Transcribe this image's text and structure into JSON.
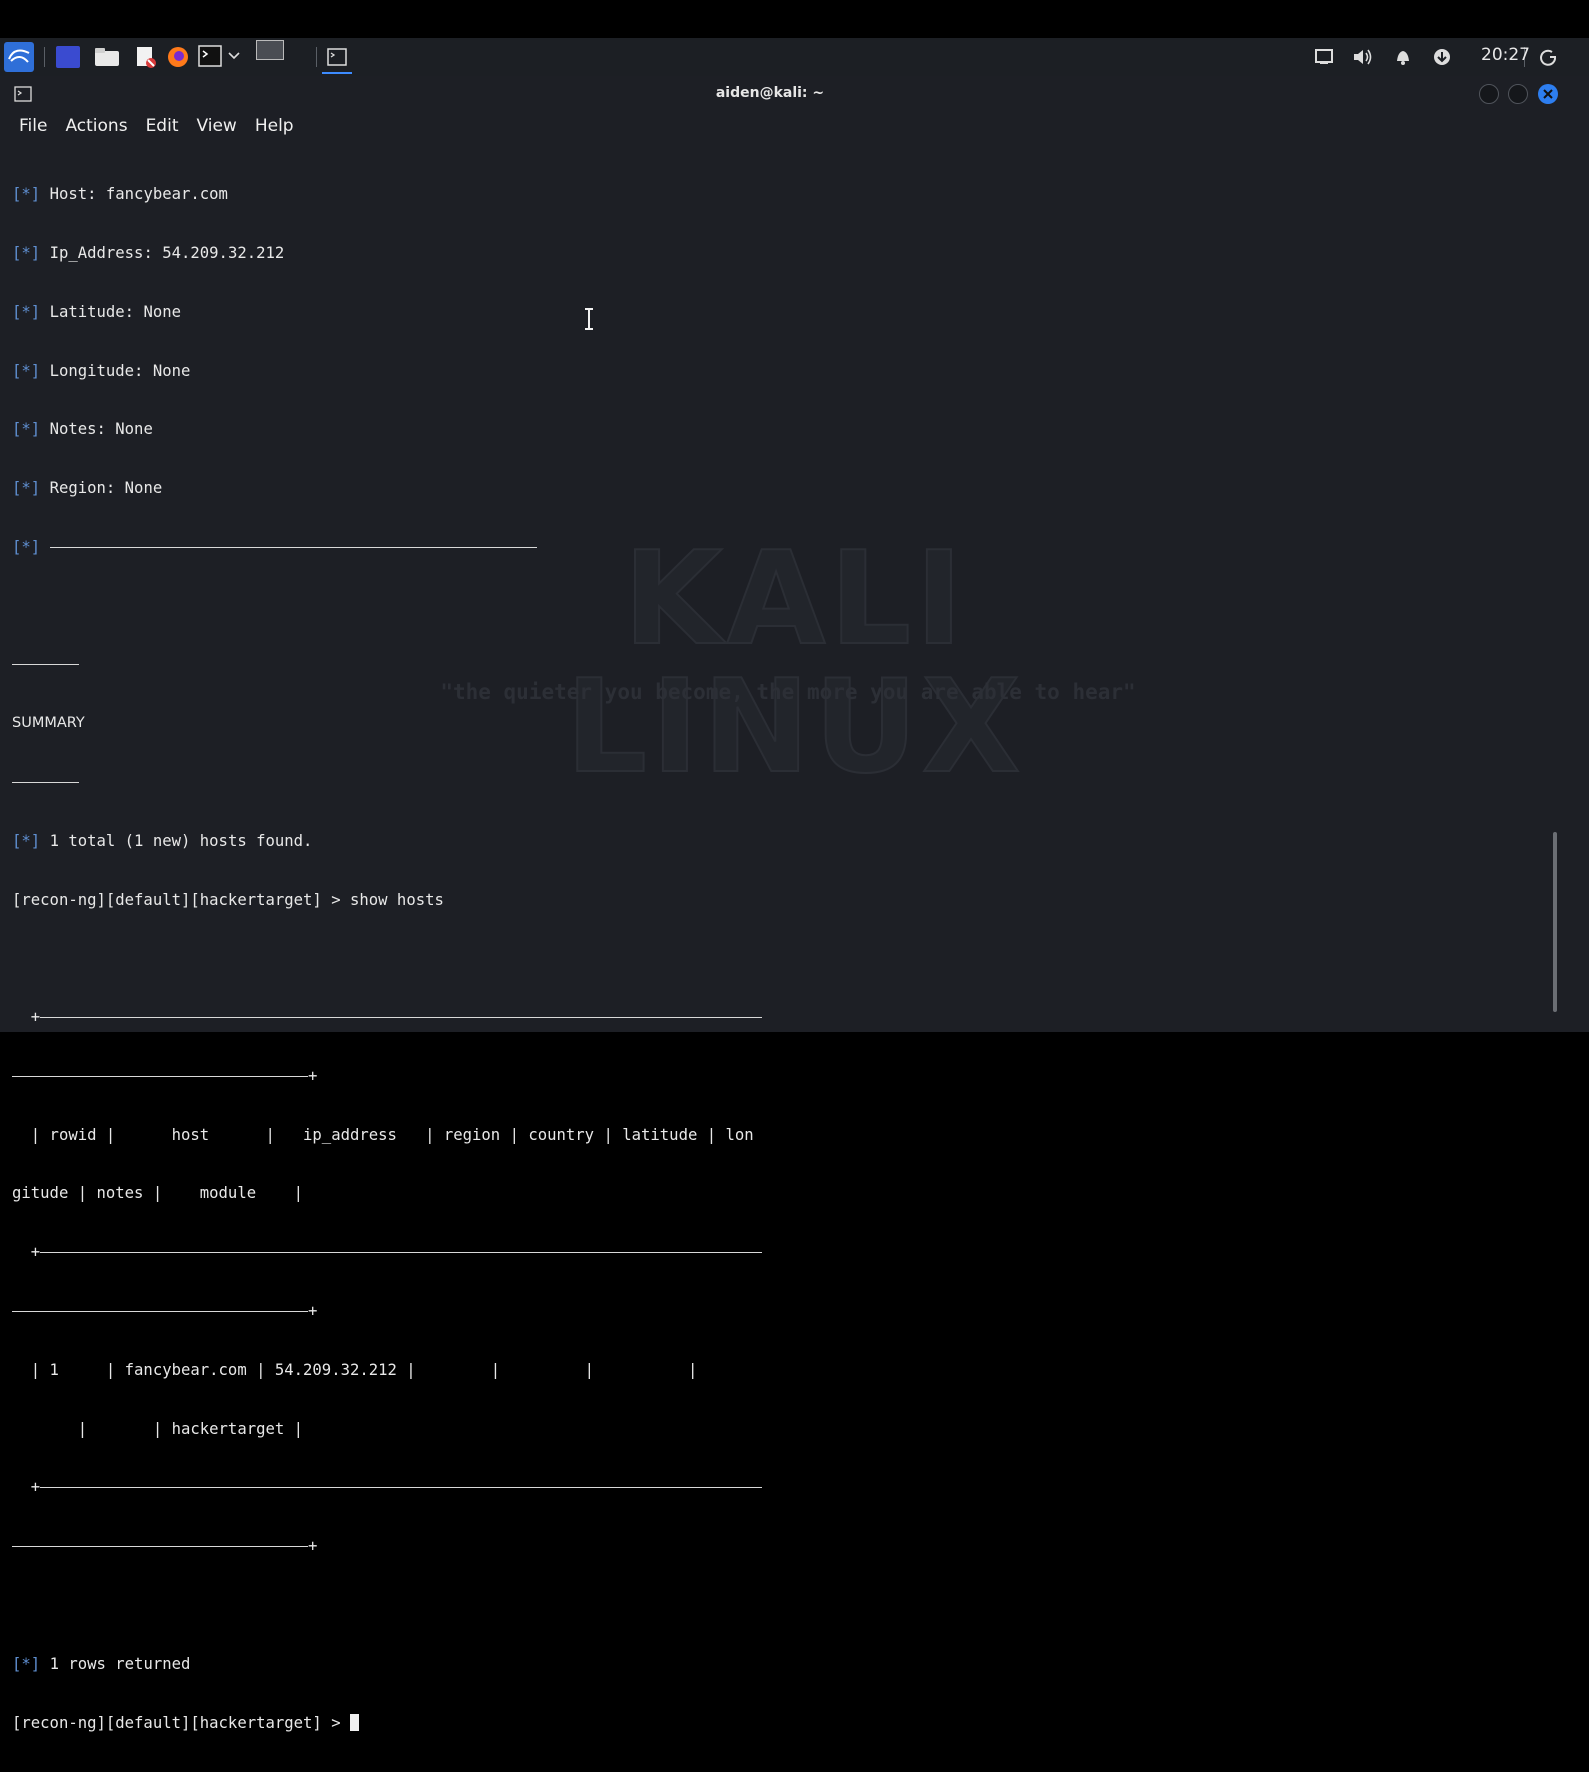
{
  "panel": {
    "clock": "20:27",
    "icons": [
      "kali-menu-icon",
      "workspace-icon",
      "file-manager-icon",
      "text-editor-icon",
      "firefox-icon",
      "terminal-icon",
      "chevron-down-icon",
      "desktop-preview-icon",
      "terminal-task-icon",
      "display-icon",
      "volume-icon",
      "bell-icon",
      "updates-icon",
      "power-icon"
    ]
  },
  "window": {
    "title": "aiden@kali: ~",
    "menu": [
      "File",
      "Actions",
      "Edit",
      "View",
      "Help"
    ]
  },
  "terminal": {
    "marker": "[*]",
    "records": [
      "Host: fancybear.com",
      "Ip_Address: 54.209.32.212",
      "Latitude: None",
      "Longitude: None",
      "Notes: None",
      "Region: None"
    ],
    "summary_label": "SUMMARY",
    "found": "1 total (1 new) hosts found.",
    "prompt": "[recon-ng][default][hackertarget] >",
    "command": "show hosts",
    "table": {
      "header_line1": "  | rowid |      host      |   ip_address   | region | country | latitude | lon",
      "header_line2": "gitude | notes |    module    |",
      "row_line1": "  | 1     | fancybear.com | 54.209.32.212 |        |         |          |",
      "row_line2": "       |       | hackertarget |"
    },
    "rows_returned": "1 rows returned"
  },
  "background": {
    "watermark": "KALI LINUX",
    "tagline": "\"the quieter you become, the more you are able to hear\""
  }
}
